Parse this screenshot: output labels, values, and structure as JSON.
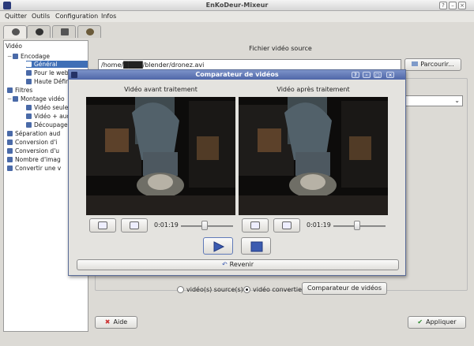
{
  "window": {
    "title": "EnKoDeur-Mixeur"
  },
  "menu": {
    "items": [
      "Quitter",
      "Outils",
      "Configuration",
      "Infos"
    ]
  },
  "tree": {
    "header": "Vidéo",
    "items": [
      {
        "label": "Encodage",
        "level": 1,
        "expander": "−"
      },
      {
        "label": "Général",
        "level": 2,
        "selected": true
      },
      {
        "label": "Pour le web",
        "level": 2
      },
      {
        "label": "Haute Défin",
        "level": 2
      },
      {
        "label": "Filtres",
        "level": 0
      },
      {
        "label": "Montage vidéo",
        "level": 1,
        "expander": "−"
      },
      {
        "label": "Vidéo seule",
        "level": 2
      },
      {
        "label": "Vidéo + aud",
        "level": 2
      },
      {
        "label": "Découpage",
        "level": 2
      },
      {
        "label": "Séparation aud",
        "level": 0
      },
      {
        "label": "Conversion d'i",
        "level": 0
      },
      {
        "label": "Conversion d'u",
        "level": 0
      },
      {
        "label": "Nombre d'imag",
        "level": 0
      },
      {
        "label": "Convertir une v",
        "level": 0
      }
    ]
  },
  "source": {
    "title": "Fichier vidéo source",
    "path": "/home/████/blender/dronez.avi",
    "browse_label": "Parcourir..."
  },
  "compare_row": {
    "radio1_label": "vidéo(s) source(s)",
    "radio2_label": "vidéo convertie",
    "compare_button": "Comparateur de vidéos"
  },
  "footer": {
    "help_label": "Aide",
    "apply_label": "Appliquer"
  },
  "dialog": {
    "title": "Comparateur de vidéos",
    "left_label": "Vidéo avant traitement",
    "right_label": "Vidéo après traitement",
    "left_time": "0:01:19",
    "right_time": "0:01:19",
    "back_label": "Revenir",
    "left_position": 0.45,
    "right_position": 0.45
  },
  "colors": {
    "accent": "#4f67a8",
    "selection": "#3f6fb6"
  }
}
